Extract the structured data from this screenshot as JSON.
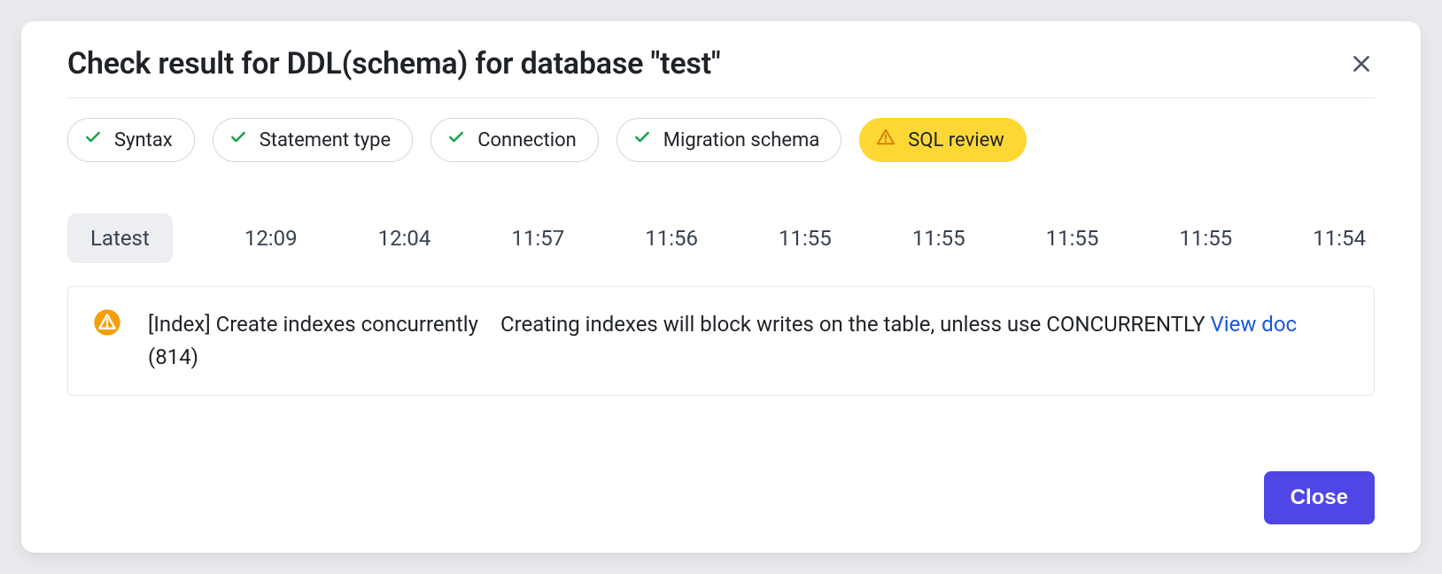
{
  "modal": {
    "title": "Check result for DDL(schema) for database \"test\"",
    "close_btn": "Close"
  },
  "checks": [
    {
      "label": "Syntax",
      "status": "ok"
    },
    {
      "label": "Statement type",
      "status": "ok"
    },
    {
      "label": "Connection",
      "status": "ok"
    },
    {
      "label": "Migration schema",
      "status": "ok"
    },
    {
      "label": "SQL review",
      "status": "warn"
    }
  ],
  "runs": {
    "latest_label": "Latest",
    "times": [
      "12:09",
      "12:04",
      "11:57",
      "11:56",
      "11:55",
      "11:55",
      "11:55",
      "11:55",
      "11:54"
    ]
  },
  "result": {
    "severity": "warn",
    "title": "[Index] Create indexes concurrently (814)",
    "description": "Creating indexes will block writes on the table, unless use CONCURRENTLY",
    "doc_link_label": "View doc"
  }
}
